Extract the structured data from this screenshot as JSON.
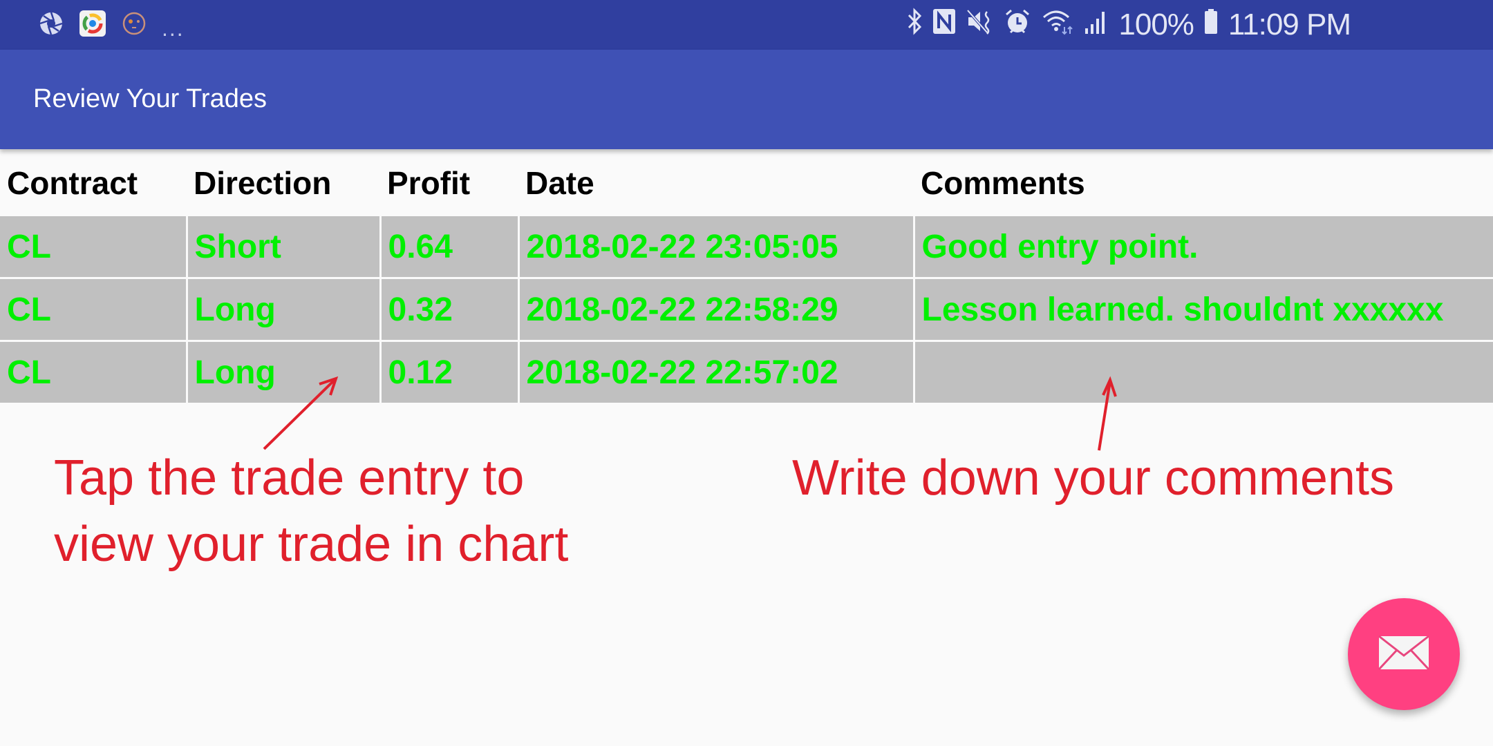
{
  "status_bar": {
    "left_icons": [
      "camera-aperture-icon",
      "app-launcher-icon",
      "face-icon",
      "more-notifications-icon"
    ],
    "overflow": "...",
    "right_icons": [
      "bluetooth-icon",
      "nfc-icon",
      "mute-vibrate-icon",
      "alarm-icon",
      "wifi-icon",
      "signal-icon",
      "battery-icon"
    ],
    "battery": "100%",
    "time": "11:09 PM"
  },
  "app_bar": {
    "title": "Review Your Trades"
  },
  "table": {
    "headers": [
      "Contract",
      "Direction",
      "Profit",
      "Date",
      "Comments"
    ],
    "rows": [
      [
        "CL",
        "Short",
        "0.64",
        "2018-02-22 23:05:05",
        "Good entry point."
      ],
      [
        "CL",
        "Long",
        "0.32",
        "2018-02-22 22:58:29",
        "Lesson learned. shouldnt xxxxxx"
      ],
      [
        "CL",
        "Long",
        "0.12",
        "2018-02-22 22:57:02",
        ""
      ]
    ]
  },
  "annotations": {
    "left_line1": "Tap the trade entry to",
    "left_line2": "view your trade in chart",
    "right": "Write down your comments"
  },
  "fab": {
    "icon": "email-icon"
  },
  "colors": {
    "status_bar": "#303f9f",
    "app_bar": "#3f51b5",
    "row_bg": "#c0c0c0",
    "row_text": "#00f000",
    "annotation": "#e0202c",
    "fab": "#ff4081"
  }
}
